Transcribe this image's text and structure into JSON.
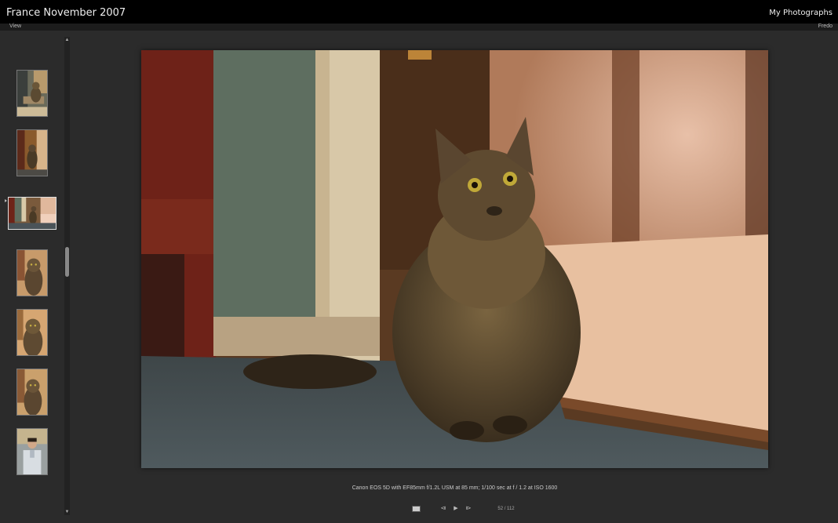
{
  "header": {
    "album_title": "France November 2007",
    "site_title": "My Photographs"
  },
  "menubar": {
    "view_label": "View",
    "user_label": "Fredo"
  },
  "filmstrip": {
    "thumbnails": [
      {
        "subject": "cat on chair"
      },
      {
        "subject": "cat in doorway"
      },
      {
        "subject": "cat sitting (selected)"
      },
      {
        "subject": "cat close-up"
      },
      {
        "subject": "cat close-up"
      },
      {
        "subject": "cat close-up"
      },
      {
        "subject": "man portrait"
      }
    ],
    "selected_index": 2
  },
  "photo": {
    "exif": "Canon EOS 5D with EF85mm f/1.2L USM at 85 mm;  1/100 sec at f / 1.2 at ISO 1600"
  },
  "controls": {
    "prev_icon": "⧏",
    "play_icon": "▶",
    "next_icon": "⧐",
    "counter": "52 / 112"
  },
  "colors": {
    "background": "#2b2b2b",
    "topbar": "#000000"
  }
}
